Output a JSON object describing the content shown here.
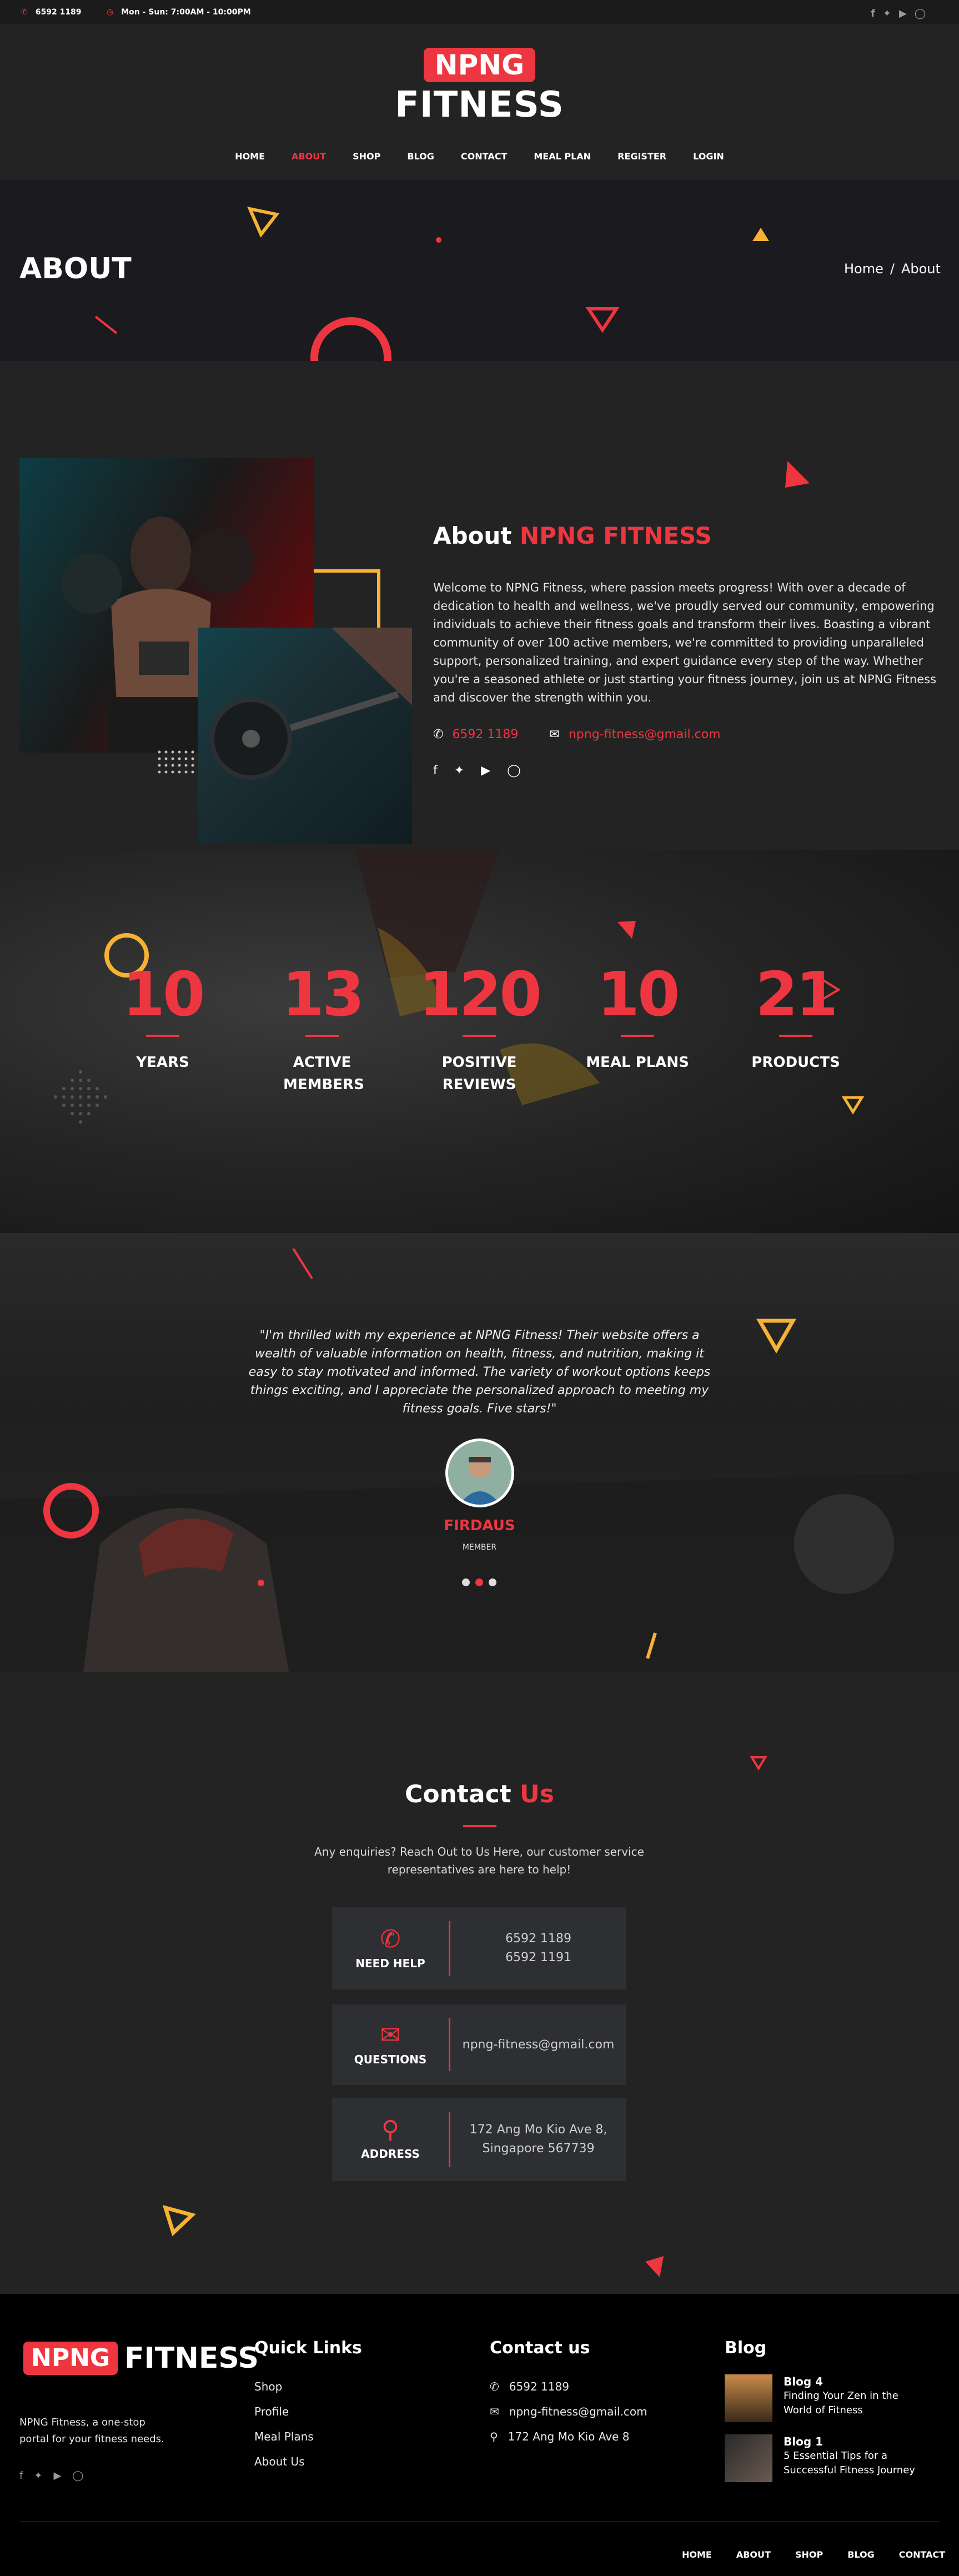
{
  "topbar": {
    "phone": "6592 1189",
    "hours": "Mon - Sun: 7:00AM - 10:00PM",
    "social_icons": [
      "facebook-icon",
      "twitter-icon",
      "youtube-icon",
      "instagram-icon"
    ]
  },
  "brand": {
    "badge": "NPNG",
    "word": "FITNESS"
  },
  "nav": [
    "HOME",
    "ABOUT",
    "SHOP",
    "BLOG",
    "CONTACT",
    "MEAL PLAN",
    "REGISTER",
    "LOGIN"
  ],
  "nav_active": "ABOUT",
  "banner": {
    "title": "ABOUT",
    "breadcrumb_home": "Home",
    "breadcrumb_sep": "/",
    "breadcrumb_current": "About"
  },
  "about": {
    "heading_prefix": "About",
    "heading_highlight": "NPNG FITNESS",
    "body": "Welcome to NPNG Fitness, where passion meets progress! With over a decade of dedication to health and wellness, we've proudly served our community, empowering individuals to achieve their fitness goals and transform their lives. Boasting a vibrant community of over 100 active members, we're committed to providing unparalleled support, personalized training, and expert guidance every step of the way. Whether you're a seasoned athlete or just starting your fitness journey, join us at NPNG Fitness and discover the strength within you.",
    "phone": "6592 1189",
    "email": "npng-fitness@gmail.com"
  },
  "stats": [
    {
      "value": "10",
      "label": "YEARS"
    },
    {
      "value": "13",
      "label": "ACTIVE MEMBERS"
    },
    {
      "value": "120",
      "label": "POSITIVE REVIEWS"
    },
    {
      "value": "10",
      "label": "MEAL PLANS"
    },
    {
      "value": "21",
      "label": "PRODUCTS"
    }
  ],
  "testimonial": {
    "quote": "\"I'm thrilled with my experience at NPNG Fitness! Their website offers a wealth of valuable information on health, fitness, and nutrition, making it easy to stay motivated and informed. The variety of workout options keeps things exciting, and I appreciate the personalized approach to meeting my fitness goals. Five stars!\"",
    "name": "FIRDAUS",
    "role": "MEMBER",
    "dots": 3,
    "active_dot": 2
  },
  "contact": {
    "heading_prefix": "Contact",
    "heading_highlight": "Us",
    "intro": "Any enquiries? Reach Out to Us Here, our customer service representatives are here to help!",
    "cards": [
      {
        "icon": "phone-call-icon",
        "label": "NEED HELP",
        "lines": [
          "6592 1189",
          "6592 1191"
        ]
      },
      {
        "icon": "envelope-icon",
        "label": "QUESTIONS",
        "lines": [
          "npng-fitness@gmail.com"
        ]
      },
      {
        "icon": "map-pin-icon",
        "label": "ADDRESS",
        "lines": [
          "172 Ang Mo Kio Ave 8,",
          "Singapore 567739"
        ]
      }
    ]
  },
  "footer": {
    "tagline": "NPNG Fitness, a one-stop portal for your fitness needs.",
    "quick_links_title": "Quick Links",
    "quick_links": [
      "Shop",
      "Profile",
      "Meal Plans",
      "About Us"
    ],
    "contact_title": "Contact us",
    "contact_phone": "6592 1189",
    "contact_email": "npng-fitness@gmail.com",
    "contact_address": "172 Ang Mo Kio Ave 8",
    "blog_title": "Blog",
    "blog_posts": [
      {
        "title": "Blog 4",
        "summary": "Finding Your Zen in the World of Fitness"
      },
      {
        "title": "Blog 1",
        "summary": "5 Essential Tips for a Successful Fitness Journey"
      }
    ],
    "bottom_nav": [
      "HOME",
      "ABOUT",
      "SHOP",
      "BLOG",
      "CONTACT"
    ]
  },
  "colors": {
    "accent": "#ee3640",
    "accent_yellow": "#f5b235",
    "bg": "#232323",
    "card": "#2d2f33"
  }
}
